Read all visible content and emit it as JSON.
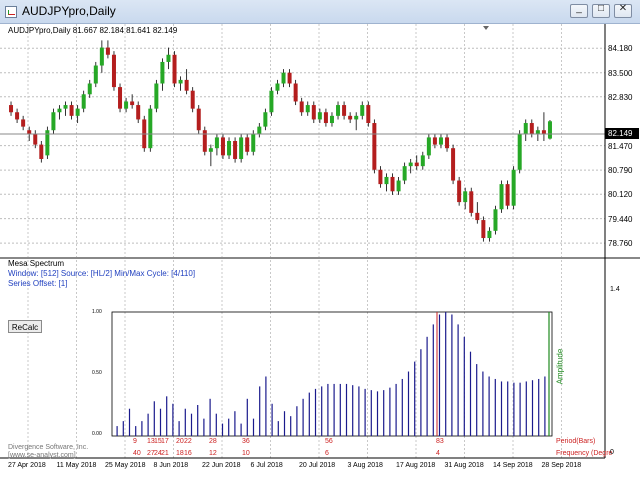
{
  "window": {
    "title": "AUDJPYpro,Daily",
    "min_label": "_",
    "max_label": "□",
    "close_label": "✕"
  },
  "chart": {
    "header": "AUDJPYpro,Daily  81.667 82.184 81.641 82.149",
    "price_labels": [
      "84.180",
      "83.500",
      "82.830",
      "81.470",
      "80.790",
      "80.120",
      "79.440",
      "78.760"
    ],
    "current_price": "82.149",
    "date_labels": [
      "27 Apr 2018",
      "11 May 2018",
      "25 May 2018",
      "8 Jun 2018",
      "22 Jun 2018",
      "6 Jul 2018",
      "20 Jul 2018",
      "3 Aug 2018",
      "17 Aug 2018",
      "31 Aug 2018",
      "14 Sep 2018",
      "28 Sep 2018"
    ],
    "up_color": "#26a826",
    "down_color": "#b41e1e"
  },
  "indicator": {
    "name": "Mesa Spectrum",
    "line1": "Window: [512] Source: [HL/2] Min/Max Cycle: [4/110]",
    "line2": "Series Offset: [1]",
    "button": "ReCalc",
    "credit1": "Divergence Software, Inc.",
    "credit2": "[www.se-analyst.com]",
    "amplitude_label": "Amplitude",
    "period_label": "Period(Bars)",
    "freq_label": "Frequency (Degre",
    "scale_top": "1.4",
    "scale_bottom": "0",
    "amp_ticks": [
      "1.00",
      "0.50",
      "0.00"
    ],
    "period_numbers": [
      "9",
      "13",
      "15",
      "17",
      "20",
      "22",
      "28",
      "36",
      "56",
      "83"
    ],
    "freq_numbers": [
      "40",
      "27",
      "24",
      "21",
      "18",
      "16",
      "12",
      "10",
      "6",
      "4"
    ],
    "bar_color": "#1a1a8c"
  },
  "chart_data": {
    "type": "candlestick",
    "ohlc": [
      [
        82.6,
        82.7,
        82.3,
        82.4
      ],
      [
        82.4,
        82.5,
        82.1,
        82.2
      ],
      [
        82.2,
        82.3,
        81.9,
        82.0
      ],
      [
        81.9,
        82.0,
        81.6,
        81.8
      ],
      [
        81.8,
        81.9,
        81.4,
        81.5
      ],
      [
        81.5,
        81.6,
        81.0,
        81.1
      ],
      [
        81.2,
        82.0,
        81.1,
        81.9
      ],
      [
        81.9,
        82.5,
        81.8,
        82.4
      ],
      [
        82.4,
        82.6,
        82.2,
        82.5
      ],
      [
        82.5,
        82.7,
        82.3,
        82.6
      ],
      [
        82.6,
        82.7,
        82.2,
        82.3
      ],
      [
        82.3,
        82.6,
        82.1,
        82.5
      ],
      [
        82.5,
        83.0,
        82.4,
        82.9
      ],
      [
        82.9,
        83.3,
        82.8,
        83.2
      ],
      [
        83.2,
        83.8,
        83.1,
        83.7
      ],
      [
        83.7,
        84.4,
        83.5,
        84.2
      ],
      [
        84.2,
        84.4,
        83.9,
        84.0
      ],
      [
        84.0,
        84.1,
        83.0,
        83.1
      ],
      [
        83.1,
        83.2,
        82.4,
        82.5
      ],
      [
        82.5,
        82.8,
        82.4,
        82.7
      ],
      [
        82.7,
        82.9,
        82.5,
        82.6
      ],
      [
        82.6,
        82.7,
        82.1,
        82.2
      ],
      [
        82.2,
        82.3,
        81.3,
        81.4
      ],
      [
        81.4,
        82.6,
        81.3,
        82.5
      ],
      [
        82.5,
        83.3,
        82.4,
        83.2
      ],
      [
        83.2,
        83.9,
        83.0,
        83.8
      ],
      [
        83.8,
        84.2,
        83.6,
        84.0
      ],
      [
        84.0,
        84.1,
        83.1,
        83.2
      ],
      [
        83.2,
        83.4,
        83.0,
        83.3
      ],
      [
        83.3,
        83.6,
        82.9,
        83.0
      ],
      [
        83.0,
        83.1,
        82.4,
        82.5
      ],
      [
        82.5,
        82.6,
        81.8,
        81.9
      ],
      [
        81.9,
        82.0,
        81.2,
        81.3
      ],
      [
        81.3,
        81.5,
        80.9,
        81.4
      ],
      [
        81.4,
        81.8,
        81.2,
        81.7
      ],
      [
        81.7,
        81.8,
        81.1,
        81.2
      ],
      [
        81.2,
        81.7,
        81.1,
        81.6
      ],
      [
        81.6,
        81.7,
        81.0,
        81.1
      ],
      [
        81.1,
        81.8,
        81.0,
        81.7
      ],
      [
        81.7,
        81.8,
        81.2,
        81.3
      ],
      [
        81.3,
        81.9,
        81.2,
        81.8
      ],
      [
        81.8,
        82.1,
        81.7,
        82.0
      ],
      [
        82.0,
        82.5,
        81.9,
        82.4
      ],
      [
        82.4,
        83.1,
        82.3,
        83.0
      ],
      [
        83.0,
        83.3,
        82.9,
        83.2
      ],
      [
        83.2,
        83.6,
        83.1,
        83.5
      ],
      [
        83.5,
        83.6,
        83.1,
        83.2
      ],
      [
        83.2,
        83.3,
        82.6,
        82.7
      ],
      [
        82.7,
        82.8,
        82.3,
        82.4
      ],
      [
        82.4,
        82.7,
        82.3,
        82.6
      ],
      [
        82.6,
        82.7,
        82.1,
        82.2
      ],
      [
        82.2,
        82.5,
        82.1,
        82.4
      ],
      [
        82.4,
        82.5,
        82.0,
        82.1
      ],
      [
        82.1,
        82.4,
        82.0,
        82.3
      ],
      [
        82.3,
        82.7,
        82.2,
        82.6
      ],
      [
        82.6,
        82.7,
        82.2,
        82.3
      ],
      [
        82.3,
        82.4,
        82.1,
        82.2
      ],
      [
        82.2,
        82.4,
        81.9,
        82.3
      ],
      [
        82.3,
        82.7,
        82.2,
        82.6
      ],
      [
        82.6,
        82.7,
        82.0,
        82.1
      ],
      [
        82.1,
        82.2,
        80.7,
        80.8
      ],
      [
        80.8,
        80.9,
        80.3,
        80.4
      ],
      [
        80.4,
        80.7,
        80.2,
        80.6
      ],
      [
        80.6,
        80.7,
        80.1,
        80.2
      ],
      [
        80.2,
        80.6,
        80.1,
        80.5
      ],
      [
        80.5,
        81.0,
        80.4,
        80.9
      ],
      [
        80.9,
        81.1,
        80.7,
        81.0
      ],
      [
        81.0,
        81.2,
        80.8,
        80.9
      ],
      [
        80.9,
        81.3,
        80.8,
        81.2
      ],
      [
        81.2,
        81.8,
        81.1,
        81.7
      ],
      [
        81.7,
        81.8,
        81.4,
        81.5
      ],
      [
        81.5,
        81.8,
        81.4,
        81.7
      ],
      [
        81.7,
        81.8,
        81.3,
        81.4
      ],
      [
        81.4,
        81.5,
        80.4,
        80.5
      ],
      [
        80.5,
        80.6,
        79.8,
        79.9
      ],
      [
        79.9,
        80.3,
        79.7,
        80.2
      ],
      [
        80.2,
        80.3,
        79.5,
        79.6
      ],
      [
        79.6,
        79.9,
        79.3,
        79.4
      ],
      [
        79.4,
        79.5,
        78.8,
        78.9
      ],
      [
        78.9,
        79.2,
        78.8,
        79.1
      ],
      [
        79.1,
        79.8,
        79.0,
        79.7
      ],
      [
        79.7,
        80.5,
        79.6,
        80.4
      ],
      [
        80.4,
        80.5,
        79.7,
        79.8
      ],
      [
        79.8,
        80.9,
        79.7,
        80.8
      ],
      [
        80.8,
        81.9,
        80.7,
        81.8
      ],
      [
        81.8,
        82.2,
        81.6,
        82.1
      ],
      [
        82.1,
        82.2,
        81.7,
        81.8
      ],
      [
        81.8,
        82.0,
        81.6,
        81.9
      ],
      [
        81.9,
        82.4,
        81.6,
        81.8
      ],
      [
        81.667,
        82.184,
        81.641,
        82.149
      ]
    ],
    "amplitudes": [
      0.08,
      0.12,
      0.22,
      0.08,
      0.12,
      0.18,
      0.28,
      0.22,
      0.32,
      0.26,
      0.12,
      0.22,
      0.18,
      0.25,
      0.14,
      0.3,
      0.18,
      0.1,
      0.14,
      0.2,
      0.1,
      0.3,
      0.14,
      0.4,
      0.48,
      0.26,
      0.12,
      0.2,
      0.16,
      0.24,
      0.3,
      0.35,
      0.38,
      0.4,
      0.42,
      0.42,
      0.42,
      0.42,
      0.41,
      0.4,
      0.38,
      0.37,
      0.36,
      0.37,
      0.39,
      0.42,
      0.46,
      0.52,
      0.6,
      0.7,
      0.8,
      0.9,
      0.98,
      1.0,
      0.98,
      0.9,
      0.8,
      0.68,
      0.58,
      0.52,
      0.48,
      0.46,
      0.44,
      0.44,
      0.43,
      0.43,
      0.44,
      0.45,
      0.46,
      0.48
    ],
    "price_range": [
      78.4,
      84.8
    ]
  }
}
